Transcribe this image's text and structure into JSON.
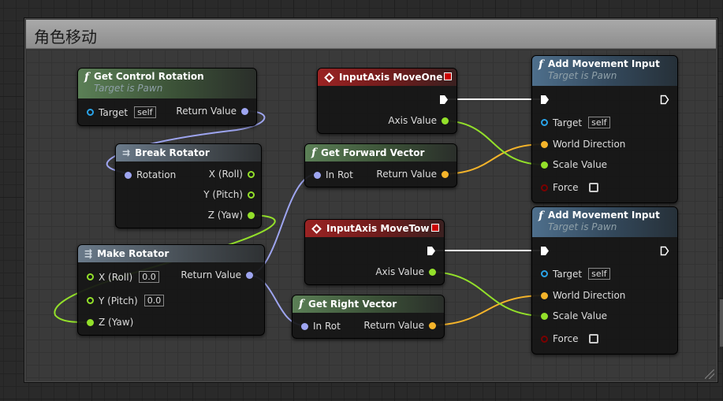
{
  "comment": {
    "title": "角色移动"
  },
  "colors": {
    "vector_pin": "#f5b42a",
    "float_pin": "#93e02a",
    "rotator_pin": "#9ea5f0",
    "object_pin": "#2aa3e8",
    "bool_pin": "#7a0000",
    "exec_wire": "#ffffff"
  },
  "nodes": {
    "get_control_rotation": {
      "title": "Get Control Rotation",
      "subtitle": "Target is Pawn",
      "target_label": "Target",
      "target_value": "self",
      "return_label": "Return Value"
    },
    "break_rotator": {
      "title": "Break Rotator",
      "rotation_label": "Rotation",
      "x_label": "X (Roll)",
      "y_label": "Y (Pitch)",
      "z_label": "Z (Yaw)"
    },
    "make_rotator": {
      "title": "Make Rotator",
      "x_label": "X (Roll)",
      "x_value": "0.0",
      "y_label": "Y (Pitch)",
      "y_value": "0.0",
      "z_label": "Z (Yaw)",
      "return_label": "Return Value"
    },
    "input_axis_move_one": {
      "title": "InputAxis MoveOne",
      "axis_label": "Axis Value"
    },
    "get_forward_vector": {
      "title": "Get Forward Vector",
      "in_label": "In Rot",
      "return_label": "Return Value"
    },
    "input_axis_move_tow": {
      "title": "InputAxis MoveTow",
      "axis_label": "Axis Value"
    },
    "get_right_vector": {
      "title": "Get Right Vector",
      "in_label": "In Rot",
      "return_label": "Return Value"
    },
    "add_movement_input_1": {
      "title": "Add Movement Input",
      "subtitle": "Target is Pawn",
      "target_label": "Target",
      "target_value": "self",
      "world_direction_label": "World Direction",
      "scale_value_label": "Scale Value",
      "force_label": "Force"
    },
    "add_movement_input_2": {
      "title": "Add Movement Input",
      "subtitle": "Target is Pawn",
      "target_label": "Target",
      "target_value": "self",
      "world_direction_label": "World Direction",
      "scale_value_label": "Scale Value",
      "force_label": "Force"
    }
  }
}
